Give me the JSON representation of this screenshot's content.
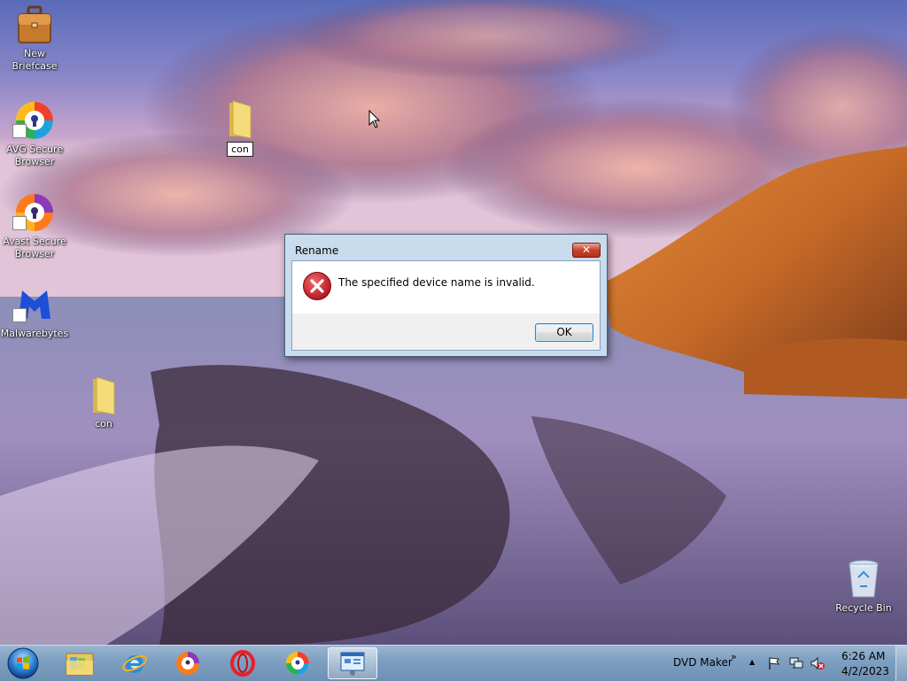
{
  "desktop": {
    "icons": [
      {
        "label": "New Briefcase"
      },
      {
        "label": "AVG Secure Browser"
      },
      {
        "label": "Avast Secure Browser"
      },
      {
        "label": "Malwarebytes"
      },
      {
        "label": "con"
      },
      {
        "label": "Recycle Bin"
      }
    ],
    "renaming_folder": {
      "value": "con"
    }
  },
  "dialog": {
    "title": "Rename",
    "close_label": "✕",
    "message": "The specified device name is invalid.",
    "icon": "error-icon",
    "ok_label": "OK"
  },
  "taskbar": {
    "pinned": [
      {
        "name": "start-button",
        "icon": "windows-orb"
      },
      {
        "name": "file-explorer",
        "icon": "folder-icon"
      },
      {
        "name": "internet-explorer",
        "icon": "ie-icon"
      },
      {
        "name": "avast-browser",
        "icon": "avast-icon"
      },
      {
        "name": "opera",
        "icon": "opera-icon"
      },
      {
        "name": "avg-browser",
        "icon": "avg-icon"
      },
      {
        "name": "rename-window",
        "icon": "window-icon",
        "active": true
      }
    ],
    "toolbar_label": "DVD Maker",
    "toolbar_chevron": "»",
    "tray_overflow": "▲",
    "clock": {
      "time": "6:26 AM",
      "date": "4/2/2023"
    }
  },
  "colors": {
    "dialog_frame": "#c9dced",
    "close_button": "#c8422b",
    "taskbar": "#7fa0c2",
    "error_red": "#c0141e"
  }
}
